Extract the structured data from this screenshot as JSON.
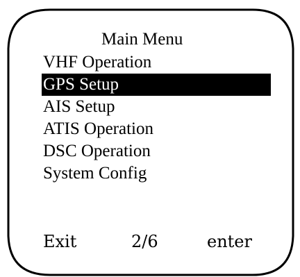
{
  "menu": {
    "title": "Main Menu",
    "items": [
      {
        "label": "VHF Operation",
        "selected": false
      },
      {
        "label": "GPS Setup",
        "selected": true
      },
      {
        "label": "AIS Setup",
        "selected": false
      },
      {
        "label": "ATIS Operation",
        "selected": false
      },
      {
        "label": "DSC Operation",
        "selected": false
      },
      {
        "label": "System Config",
        "selected": false
      }
    ]
  },
  "softkeys": {
    "left": "Exit",
    "page_indicator": "2/6",
    "right": "enter"
  },
  "colors": {
    "background": "#ffffff",
    "foreground": "#000000",
    "highlight": "#000000",
    "highlight_text": "#ffffff"
  }
}
